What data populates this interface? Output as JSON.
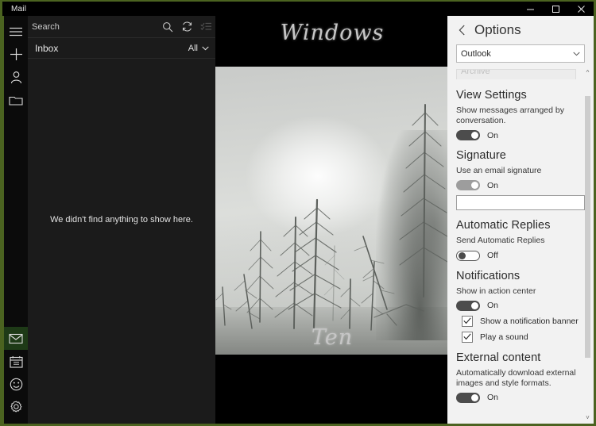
{
  "window": {
    "title": "Mail",
    "accent_green": "#4b6320",
    "controls": [
      {
        "name": "minimize",
        "glyph": "minimize-icon"
      },
      {
        "name": "maximize",
        "glyph": "maximize-icon"
      },
      {
        "name": "close",
        "glyph": "close-icon"
      }
    ]
  },
  "rail": {
    "top_items": [
      {
        "name": "hamburger-menu",
        "label": "Menu"
      },
      {
        "name": "new-mail",
        "label": "New mail"
      },
      {
        "name": "accounts",
        "label": "Accounts"
      },
      {
        "name": "folders",
        "label": "Folders"
      }
    ],
    "bottom_items": [
      {
        "name": "mail",
        "label": "Mail",
        "active": true
      },
      {
        "name": "calendar",
        "label": "Calendar",
        "active": false
      },
      {
        "name": "feedback",
        "label": "Feedback",
        "active": false
      },
      {
        "name": "settings",
        "label": "Settings",
        "active": false
      }
    ]
  },
  "message_list": {
    "search_placeholder": "Search",
    "search_value": "",
    "toolbar": [
      {
        "name": "search-icon",
        "enabled": true
      },
      {
        "name": "sync-icon",
        "enabled": true
      },
      {
        "name": "selection-mode-icon",
        "enabled": false
      }
    ],
    "folder_name": "Inbox",
    "filter_label": "All",
    "empty_text": "We didn't find anything to show here."
  },
  "reading_pane": {
    "brand_top": "Windows",
    "brand_bottom": "Ten",
    "image_description": "Foggy winter forest with bare frosted trees in snow"
  },
  "options": {
    "header_title": "Options",
    "back_label": "Back",
    "account": {
      "label": "Outlook",
      "options": [
        "Outlook"
      ]
    },
    "clipped_field": {
      "label": "Archive"
    },
    "sections": [
      {
        "id": "view-settings",
        "title": "View Settings",
        "description": "Show messages arranged by conversation.",
        "toggle": {
          "state": "On",
          "value": true,
          "style": "on"
        }
      },
      {
        "id": "signature",
        "title": "Signature",
        "description": "Use an email signature",
        "toggle": {
          "state": "On",
          "value": true,
          "style": "on-dim"
        },
        "signature_text": ""
      },
      {
        "id": "automatic-replies",
        "title": "Automatic Replies",
        "description": "Send Automatic Replies",
        "toggle": {
          "state": "Off",
          "value": false,
          "style": "off"
        }
      },
      {
        "id": "notifications",
        "title": "Notifications",
        "description": "Show in action center",
        "toggle": {
          "state": "On",
          "value": true,
          "style": "on"
        },
        "checkboxes": [
          {
            "label": "Show a notification banner",
            "checked": true
          },
          {
            "label": "Play a sound",
            "checked": true
          }
        ]
      },
      {
        "id": "external-content",
        "title": "External content",
        "description": "Automatically download external images and style formats.",
        "toggle": {
          "state": "On",
          "value": true,
          "style": "on"
        }
      }
    ]
  }
}
